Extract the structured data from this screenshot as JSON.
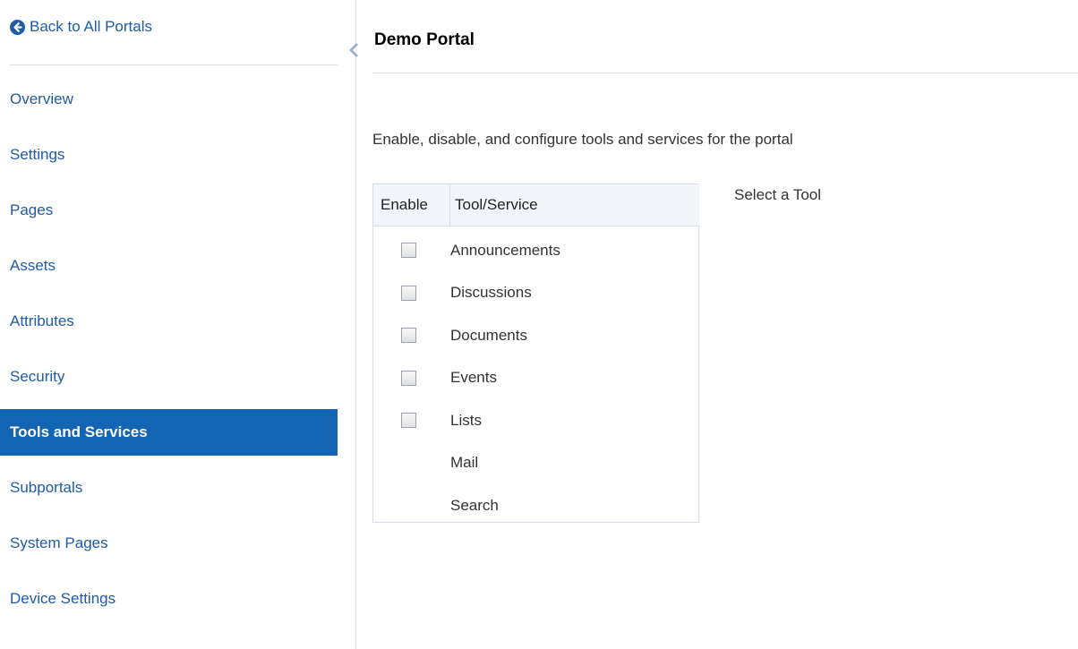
{
  "sidebar": {
    "back_link": "Back to All Portals",
    "items": [
      {
        "label": "Overview"
      },
      {
        "label": "Settings"
      },
      {
        "label": "Pages"
      },
      {
        "label": "Assets"
      },
      {
        "label": "Attributes"
      },
      {
        "label": "Security"
      },
      {
        "label": "Tools and Services",
        "active": true
      },
      {
        "label": "Subportals"
      },
      {
        "label": "System Pages"
      },
      {
        "label": "Device Settings"
      }
    ]
  },
  "main": {
    "title": "Demo Portal",
    "description": "Enable, disable, and configure tools and services for the portal",
    "table": {
      "headers": {
        "enable": "Enable",
        "tool": "Tool/Service"
      },
      "rows": [
        {
          "name": "Announcements",
          "has_checkbox": true,
          "checked": false
        },
        {
          "name": "Discussions",
          "has_checkbox": true,
          "checked": false
        },
        {
          "name": "Documents",
          "has_checkbox": true,
          "checked": false
        },
        {
          "name": "Events",
          "has_checkbox": true,
          "checked": false
        },
        {
          "name": "Lists",
          "has_checkbox": true,
          "checked": false
        },
        {
          "name": "Mail",
          "has_checkbox": false
        },
        {
          "name": "Search",
          "has_checkbox": false
        }
      ]
    },
    "detail_prompt": "Select a Tool"
  },
  "colors": {
    "link": "#1f5ba8",
    "active_bg": "#1464b4",
    "active_text": "#ffffff"
  },
  "icons": {
    "back": "arrow-left-circle-icon",
    "collapse": "chevron-left-icon"
  }
}
